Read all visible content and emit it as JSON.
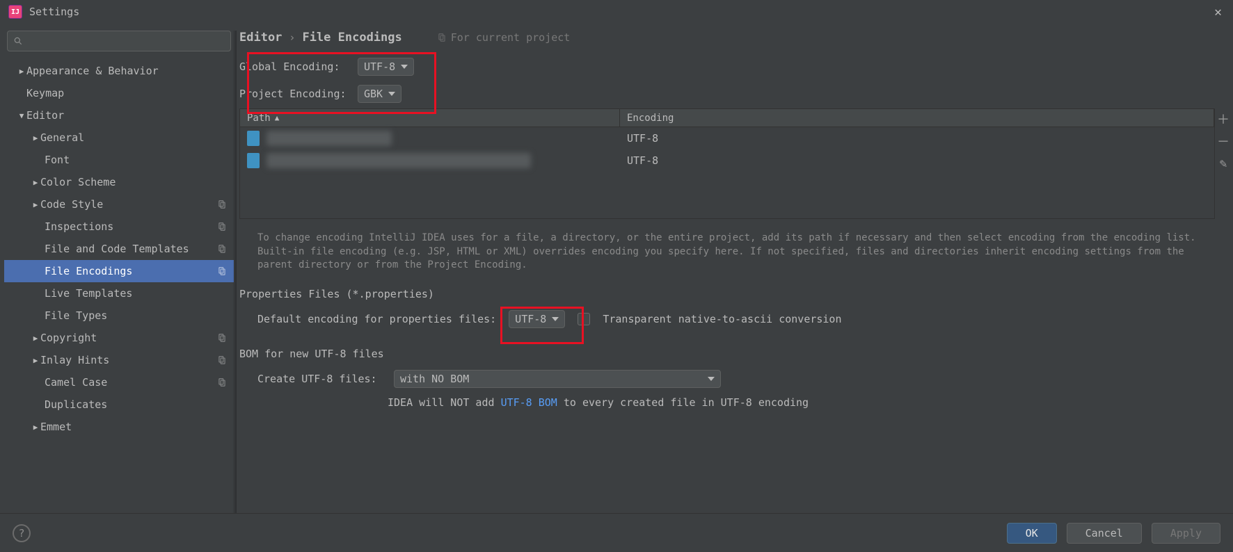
{
  "title": "Settings",
  "sidebar": {
    "items": [
      {
        "label": "Appearance & Behavior"
      },
      {
        "label": "Keymap"
      },
      {
        "label": "Editor"
      },
      {
        "label": "General"
      },
      {
        "label": "Font"
      },
      {
        "label": "Color Scheme"
      },
      {
        "label": "Code Style"
      },
      {
        "label": "Inspections"
      },
      {
        "label": "File and Code Templates"
      },
      {
        "label": "File Encodings"
      },
      {
        "label": "Live Templates"
      },
      {
        "label": "File Types"
      },
      {
        "label": "Copyright"
      },
      {
        "label": "Inlay Hints"
      },
      {
        "label": "Camel Case"
      },
      {
        "label": "Duplicates"
      },
      {
        "label": "Emmet"
      }
    ]
  },
  "breadcrumb": {
    "a": "Editor",
    "b": "File Encodings",
    "scope": "For current project"
  },
  "encoding": {
    "global_label": "Global Encoding:",
    "global_value": "UTF-8",
    "project_label": "Project Encoding:",
    "project_value": "GBK"
  },
  "table": {
    "col_path": "Path",
    "col_enc": "Encoding",
    "rows": [
      {
        "encoding": "UTF-8"
      },
      {
        "encoding": "UTF-8"
      }
    ]
  },
  "hint_text": "To change encoding IntelliJ IDEA uses for a file, a directory, or the entire project, add its path if necessary and then select encoding from the encoding list. Built-in file encoding (e.g. JSP, HTML or XML) overrides encoding you specify here. If not specified, files and directories inherit encoding settings from the parent directory or from the Project Encoding.",
  "properties": {
    "section": "Properties Files (*.properties)",
    "default_label": "Default encoding for properties files:",
    "default_value": "UTF-8",
    "transparent_label": "Transparent native-to-ascii conversion"
  },
  "bom": {
    "section": "BOM for new UTF-8 files",
    "create_label": "Create UTF-8 files:",
    "create_value": "with NO BOM",
    "note_prefix": "IDEA will NOT add ",
    "note_link": "UTF-8 BOM",
    "note_suffix": " to every created file in UTF-8 encoding"
  },
  "footer": {
    "ok": "OK",
    "cancel": "Cancel",
    "apply": "Apply"
  }
}
